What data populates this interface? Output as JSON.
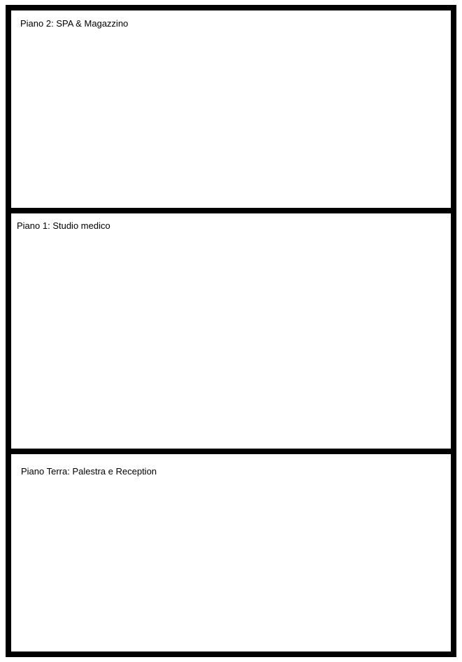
{
  "floors": [
    {
      "label": "Piano 2: SPA & Magazzino"
    },
    {
      "label": "Piano 1: Studio medico"
    },
    {
      "label": "Piano Terra: Palestra e Reception"
    }
  ],
  "colors": {
    "border": "#000000",
    "background": "#ffffff",
    "text": "#000000"
  }
}
